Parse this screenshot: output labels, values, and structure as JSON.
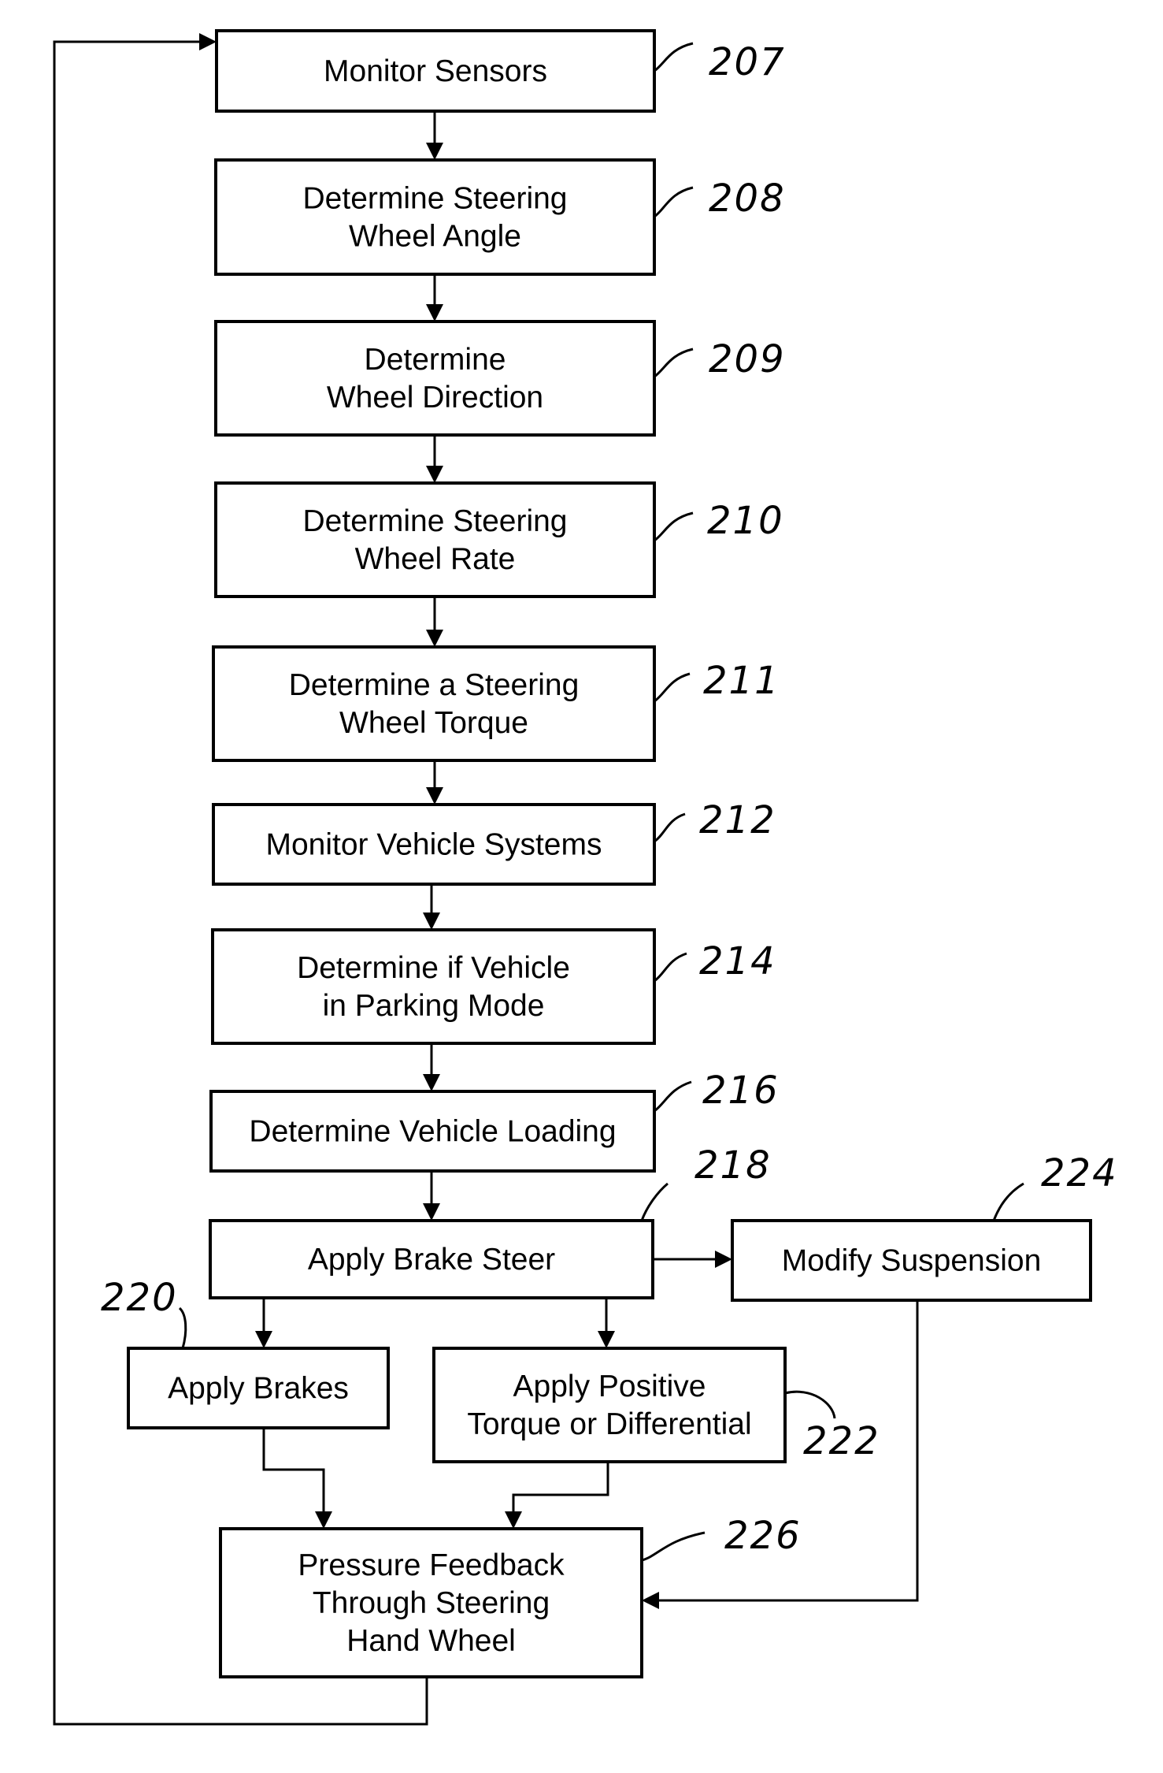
{
  "figure": {
    "type": "flowchart",
    "description": "Brake steer control method flowchart"
  },
  "steps": [
    {
      "id": "207",
      "lines": [
        "Monitor Sensors"
      ]
    },
    {
      "id": "208",
      "lines": [
        "Determine Steering",
        "Wheel Angle"
      ]
    },
    {
      "id": "209",
      "lines": [
        "Determine",
        "Wheel Direction"
      ]
    },
    {
      "id": "210",
      "lines": [
        "Determine Steering",
        "Wheel Rate"
      ]
    },
    {
      "id": "211",
      "lines": [
        "Determine a Steering",
        "Wheel Torque"
      ]
    },
    {
      "id": "212",
      "lines": [
        "Monitor Vehicle Systems"
      ]
    },
    {
      "id": "214",
      "lines": [
        "Determine if Vehicle",
        "in Parking Mode"
      ]
    },
    {
      "id": "216",
      "lines": [
        "Determine Vehicle Loading"
      ]
    },
    {
      "id": "218",
      "lines": [
        "Apply Brake Steer"
      ]
    },
    {
      "id": "224",
      "lines": [
        "Modify Suspension"
      ]
    },
    {
      "id": "220",
      "lines": [
        "Apply Brakes"
      ]
    },
    {
      "id": "222",
      "lines": [
        "Apply Positive",
        "Torque or Differential"
      ]
    },
    {
      "id": "226",
      "lines": [
        "Pressure Feedback",
        "Through Steering",
        "Hand Wheel"
      ]
    }
  ],
  "connections": [
    {
      "from": "207",
      "to": "208"
    },
    {
      "from": "208",
      "to": "209"
    },
    {
      "from": "209",
      "to": "210"
    },
    {
      "from": "210",
      "to": "211"
    },
    {
      "from": "211",
      "to": "212"
    },
    {
      "from": "212",
      "to": "214"
    },
    {
      "from": "214",
      "to": "216"
    },
    {
      "from": "216",
      "to": "218"
    },
    {
      "from": "218",
      "to": "224"
    },
    {
      "from": "218",
      "to": "220"
    },
    {
      "from": "218",
      "to": "222"
    },
    {
      "from": "220",
      "to": "226"
    },
    {
      "from": "222",
      "to": "226"
    },
    {
      "from": "224",
      "to": "226"
    },
    {
      "from": "226",
      "to": "207",
      "kind": "feedback-loop"
    }
  ]
}
